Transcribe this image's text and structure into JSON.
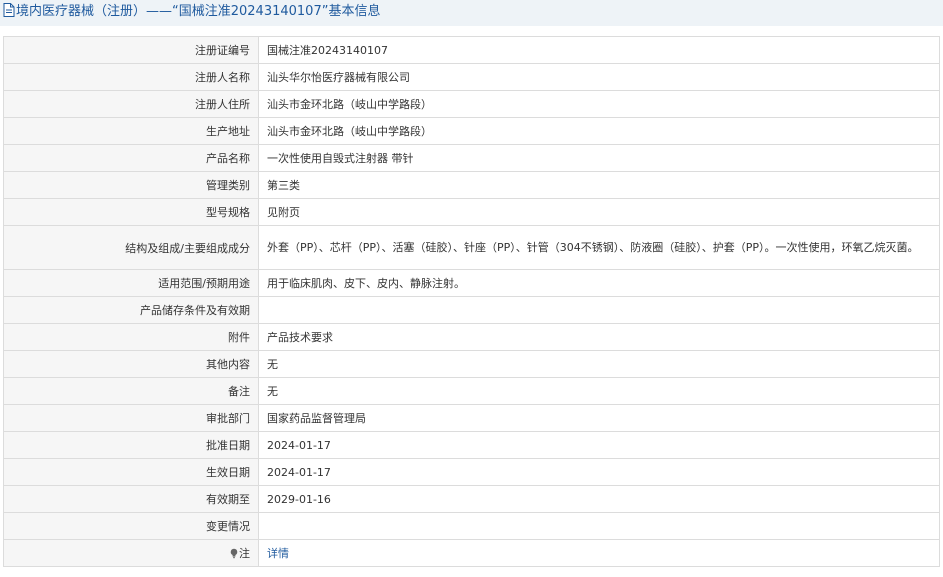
{
  "header": {
    "icon": "document-icon",
    "title": "境内医疗器械（注册）——“国械注准20243140107”基本信息"
  },
  "rows": [
    {
      "label": "注册证编号",
      "value": "国械注准20243140107"
    },
    {
      "label": "注册人名称",
      "value": "汕头华尔怡医疗器械有限公司"
    },
    {
      "label": "注册人住所",
      "value": "汕头市金环北路（岐山中学路段）"
    },
    {
      "label": "生产地址",
      "value": "汕头市金环北路（岐山中学路段）"
    },
    {
      "label": "产品名称",
      "value": "一次性使用自毁式注射器 带针"
    },
    {
      "label": "管理类别",
      "value": "第三类"
    },
    {
      "label": "型号规格",
      "value": "见附页"
    },
    {
      "label": "结构及组成/主要组成成分",
      "value": "外套（PP）、芯杆（PP）、活塞（硅胶）、针座（PP）、针管（304不锈钢）、防液圈（硅胶）、护套（PP）。一次性使用，环氧乙烷灭菌。"
    },
    {
      "label": "适用范围/预期用途",
      "value": "用于临床肌肉、皮下、皮内、静脉注射。"
    },
    {
      "label": "产品储存条件及有效期",
      "value": ""
    },
    {
      "label": "附件",
      "value": "产品技术要求"
    },
    {
      "label": "其他内容",
      "value": "无"
    },
    {
      "label": "备注",
      "value": "无"
    },
    {
      "label": "审批部门",
      "value": "国家药品监督管理局"
    },
    {
      "label": "批准日期",
      "value": "2024-01-17"
    },
    {
      "label": "生效日期",
      "value": "2024-01-17"
    },
    {
      "label": "有效期至",
      "value": "2029-01-16"
    },
    {
      "label": "变更情况",
      "value": ""
    },
    {
      "label": "注",
      "icon": "lightbulb-icon",
      "value": "详情"
    }
  ],
  "colors": {
    "header_bg": "#eef3f7",
    "header_text": "#1f5a9e",
    "label_bg": "#f6f6f6",
    "border": "#dcdcdc",
    "link": "#1f5a9e"
  }
}
